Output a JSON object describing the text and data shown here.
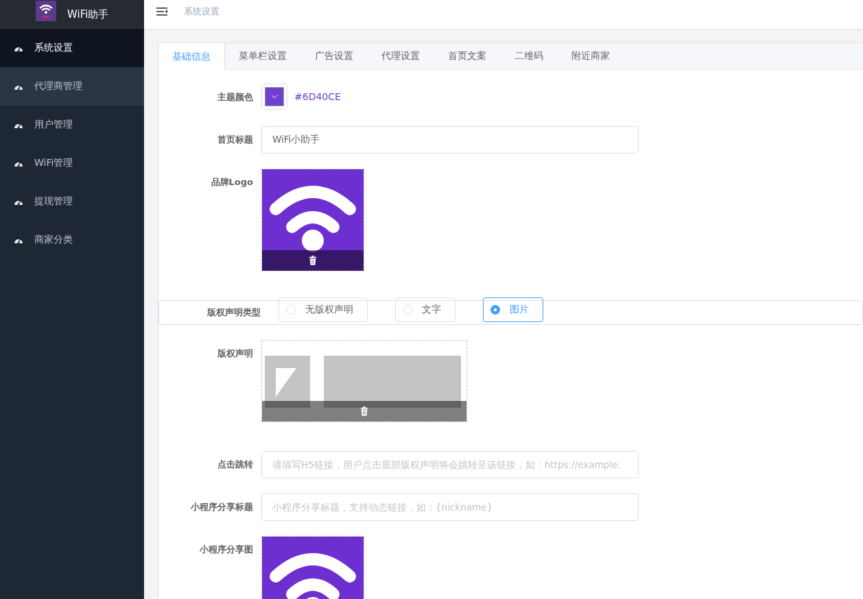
{
  "app": {
    "title": "WiFi助手"
  },
  "sidebar": {
    "items": [
      {
        "label": "系统设置",
        "selected": true,
        "highlighted": false
      },
      {
        "label": "代理商管理",
        "selected": false,
        "highlighted": true
      },
      {
        "label": "用户管理",
        "selected": false,
        "highlighted": false
      },
      {
        "label": "WiFi管理",
        "selected": false,
        "highlighted": false
      },
      {
        "label": "提现管理",
        "selected": false,
        "highlighted": false
      },
      {
        "label": "商家分类",
        "selected": false,
        "highlighted": false
      }
    ]
  },
  "breadcrumb": "系统设置",
  "tabs": [
    {
      "label": "基础信息",
      "selected": true
    },
    {
      "label": "菜单栏设置",
      "selected": false
    },
    {
      "label": "广告设置",
      "selected": false
    },
    {
      "label": "代理设置",
      "selected": false
    },
    {
      "label": "首页文案",
      "selected": false
    },
    {
      "label": "二维码",
      "selected": false
    },
    {
      "label": "附近商家",
      "selected": false
    }
  ],
  "form": [
    {
      "kind": "color",
      "label": "主题颜色",
      "value": "#6D40CE",
      "color": "#6d40ce"
    },
    {
      "kind": "text",
      "label": "首页标题",
      "value": "WiFi小助手"
    },
    {
      "kind": "logo-image",
      "label": "品牌Logo",
      "deletable": true
    },
    {
      "kind": "radio",
      "label": "版权声明类型",
      "options": [
        {
          "label": "无版权声明",
          "selected": false
        },
        {
          "label": "文字",
          "selected": false
        },
        {
          "label": "图片",
          "selected": true
        }
      ]
    },
    {
      "kind": "banner-image",
      "label": "版权声明",
      "deletable": true
    },
    {
      "kind": "text",
      "label": "点击跳转",
      "placeholder": "请填写H5链接，用户点击底部版权声明将会跳转至该链接，如：https://example."
    },
    {
      "kind": "text",
      "label": "小程序分享标题",
      "placeholder": "小程序分享标题，支持动态链接，如：{nickname}"
    },
    {
      "kind": "logo-image",
      "label": "小程序分享图"
    }
  ]
}
